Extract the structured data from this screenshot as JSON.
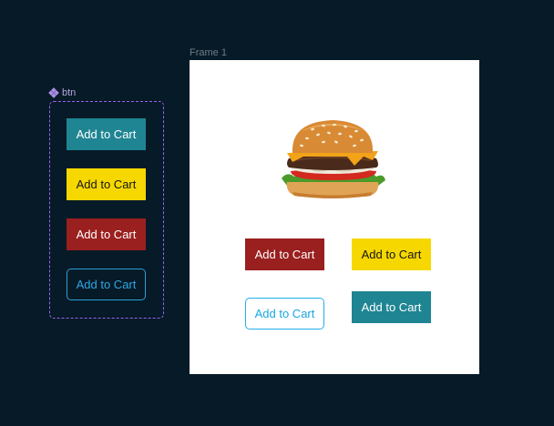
{
  "component_set": {
    "name": "btn",
    "buttons": [
      {
        "label": "Add to Cart",
        "variant": "teal",
        "color": "#1f8593"
      },
      {
        "label": "Add to Cart",
        "variant": "yellow",
        "color": "#f6d800"
      },
      {
        "label": "Add to Cart",
        "variant": "red",
        "color": "#9a1f1f"
      },
      {
        "label": "Add to Cart",
        "variant": "outline",
        "color": "#2f9fd6"
      }
    ]
  },
  "frame": {
    "name": "Frame 1",
    "image": "burger-image",
    "buttons": [
      {
        "label": "Add to Cart",
        "variant": "red"
      },
      {
        "label": "Add to Cart",
        "variant": "yellow"
      },
      {
        "label": "Add to Cart",
        "variant": "outline"
      },
      {
        "label": "Add to Cart",
        "variant": "teal"
      }
    ]
  },
  "colors": {
    "canvas": "#061a27",
    "component_border": "#9b62f0",
    "frame_background": "#ffffff"
  }
}
